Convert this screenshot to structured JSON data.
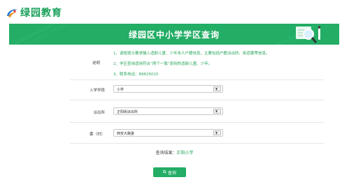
{
  "header": {
    "logo_text": "绿园教育"
  },
  "banner": {
    "title": "绿园区中小学学区查询"
  },
  "info": {
    "label": "说明",
    "lines": [
      "1、请按提示要求输入适龄儿童、少年本人户籍信息，主要包括户籍派出所、街道委等信息。",
      "2、学区查询适用符合“两个一致”原则的适龄儿童、少年。",
      "3、联系电话：89625015"
    ]
  },
  "form": {
    "stage_label": "入学学段",
    "stage_value": "小学",
    "station_label": "派出所",
    "station_value": "正阳街派出所",
    "committee_label": "委（村）",
    "committee_value": "西安大路委"
  },
  "result": {
    "label": "查询结果：",
    "value": "正阳小学"
  },
  "button": {
    "label": "查询"
  },
  "colors": {
    "brand_green": "#23ad65",
    "accent_green": "#1fa45a"
  }
}
